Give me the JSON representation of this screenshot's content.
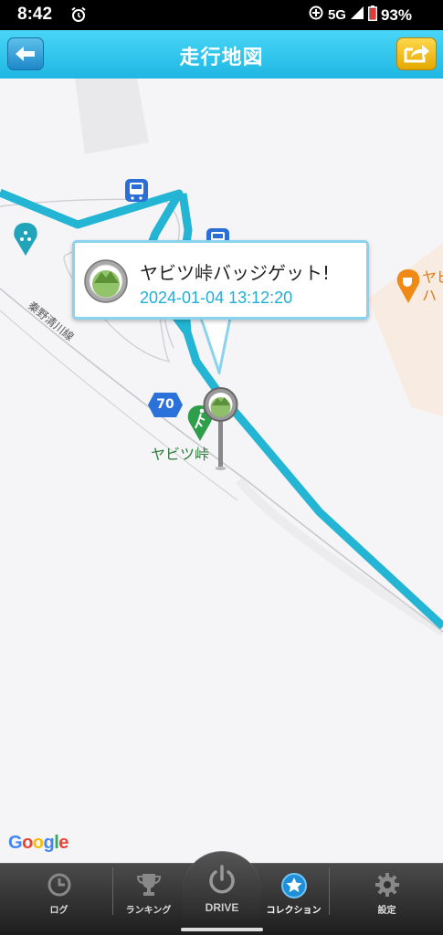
{
  "status_bar": {
    "time": "8:42",
    "network": "5G",
    "battery": "93%"
  },
  "header": {
    "title": "走行地図"
  },
  "map": {
    "road_name": "秦野清川線",
    "route_number": "70",
    "pass_name": "ヤビツ峠",
    "poi_partial": "ヤビ\nハ",
    "google_logo": "Google",
    "route_color": "#23b5d3"
  },
  "callout": {
    "title": "ヤビツ峠バッジゲット!",
    "datetime": "2024-01-04 13:12:20"
  },
  "bottom_nav": {
    "items": [
      {
        "label": "ログ",
        "icon": "clock-icon"
      },
      {
        "label": "ランキング",
        "icon": "trophy-icon"
      },
      {
        "label": "DRIVE",
        "icon": "power-icon"
      },
      {
        "label": "コレクション",
        "icon": "star-icon"
      },
      {
        "label": "設定",
        "icon": "gear-icon"
      }
    ],
    "active_index": 3
  }
}
